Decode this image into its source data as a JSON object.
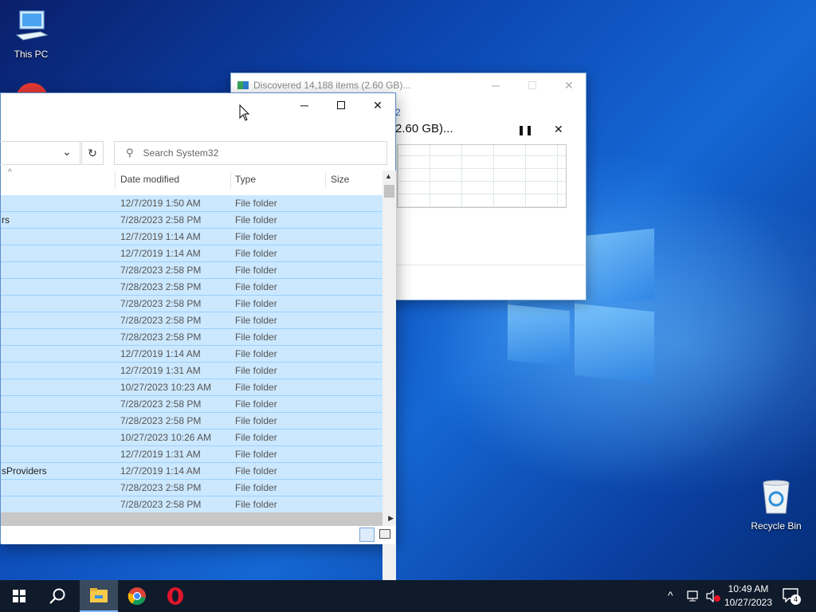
{
  "desktop": {
    "icons": [
      {
        "label": "This PC",
        "icon": "computer-icon"
      },
      {
        "label": "Recycle Bin",
        "icon": "recycle-bin-icon"
      }
    ]
  },
  "progress_dialog": {
    "title": "Discovered 14,188 items (2.60 GB)...",
    "partial_text_top": "2",
    "status_text": "2.60 GB)...",
    "pause_icon": "pause-icon",
    "close_icon": "close-icon"
  },
  "explorer": {
    "search_placeholder": "Search System32",
    "refresh_symbol": "↻",
    "columns": {
      "name": "",
      "date": "Date modified",
      "type": "Type",
      "size": "Size"
    },
    "rows": [
      {
        "name": "",
        "date": "12/7/2019 1:50 AM",
        "type": "File folder"
      },
      {
        "name": "rs",
        "date": "7/28/2023 2:58 PM",
        "type": "File folder"
      },
      {
        "name": "",
        "date": "12/7/2019 1:14 AM",
        "type": "File folder"
      },
      {
        "name": "",
        "date": "12/7/2019 1:14 AM",
        "type": "File folder"
      },
      {
        "name": "",
        "date": "7/28/2023 2:58 PM",
        "type": "File folder"
      },
      {
        "name": "",
        "date": "7/28/2023 2:58 PM",
        "type": "File folder"
      },
      {
        "name": "",
        "date": "7/28/2023 2:58 PM",
        "type": "File folder"
      },
      {
        "name": "",
        "date": "7/28/2023 2:58 PM",
        "type": "File folder"
      },
      {
        "name": "",
        "date": "7/28/2023 2:58 PM",
        "type": "File folder"
      },
      {
        "name": "",
        "date": "12/7/2019 1:14 AM",
        "type": "File folder"
      },
      {
        "name": "",
        "date": "12/7/2019 1:31 AM",
        "type": "File folder"
      },
      {
        "name": "",
        "date": "10/27/2023 10:23 AM",
        "type": "File folder"
      },
      {
        "name": "",
        "date": "7/28/2023 2:58 PM",
        "type": "File folder"
      },
      {
        "name": "",
        "date": "7/28/2023 2:58 PM",
        "type": "File folder"
      },
      {
        "name": "",
        "date": "10/27/2023 10:26 AM",
        "type": "File folder"
      },
      {
        "name": "",
        "date": "12/7/2019 1:31 AM",
        "type": "File folder"
      },
      {
        "name": "sProviders",
        "date": "12/7/2019 1:14 AM",
        "type": "File folder"
      },
      {
        "name": "",
        "date": "7/28/2023 2:58 PM",
        "type": "File folder"
      },
      {
        "name": "",
        "date": "7/28/2023 2:58 PM",
        "type": "File folder"
      }
    ]
  },
  "taskbar": {
    "items": [
      "start-icon",
      "search-icon",
      "file-explorer-icon",
      "chrome-icon",
      "opera-icon"
    ],
    "time": "10:49 AM",
    "date": "10/27/2023",
    "notification_count": "4"
  }
}
